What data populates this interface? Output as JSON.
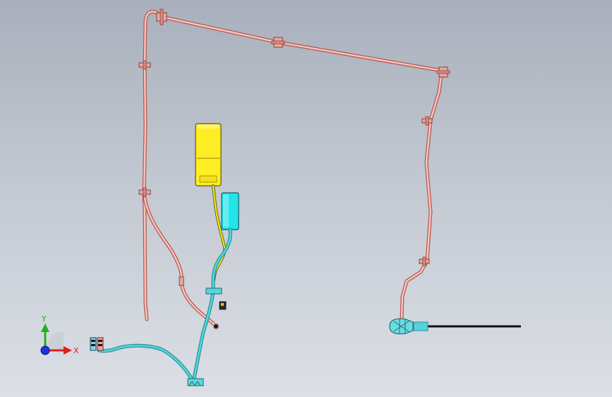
{
  "view": {
    "title": "",
    "background": {
      "top": "#a8b0bc",
      "bottom": "#dcdfe6"
    }
  },
  "triad": {
    "x_label": "X",
    "y_label": "Y",
    "x_color": "#e02020",
    "y_color": "#20b020",
    "z_color": "#2030e0"
  },
  "colors": {
    "harness_pink": "#e8a39a",
    "harness_pink_edge": "#b85a52",
    "harness_cyan": "#56d6dc",
    "harness_cyan_edge": "#2a8f98",
    "yellow_box": "#ffee22",
    "cyan_box": "#22e5ec",
    "probe": "#111111",
    "clip": "#e7a8a0"
  },
  "components": [
    {
      "name": "yellow-enclosure",
      "description": ""
    },
    {
      "name": "cyan-enclosure",
      "description": ""
    },
    {
      "name": "connector-housing",
      "description": ""
    },
    {
      "name": "sensor-probe",
      "description": ""
    }
  ]
}
